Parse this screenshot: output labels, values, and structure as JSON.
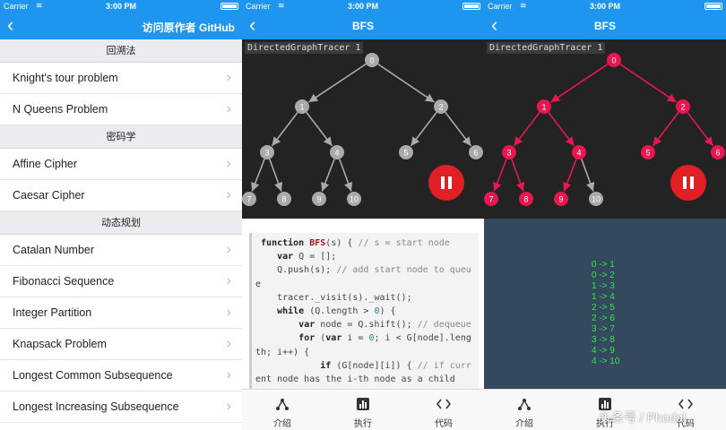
{
  "status": {
    "carrier": "Carrier",
    "time": "3:00 PM"
  },
  "panel1": {
    "nav_title": "访问原作者 GitHub",
    "sections": [
      {
        "title": "回溯法",
        "items": [
          "Knight's tour problem",
          "N Queens Problem"
        ]
      },
      {
        "title": "密码学",
        "items": [
          "Affine Cipher",
          "Caesar Cipher"
        ]
      },
      {
        "title": "动态规划",
        "items": [
          "Catalan Number",
          "Fibonacci Sequence",
          "Integer Partition",
          "Knapsack Problem",
          "Longest Common Subsequence",
          "Longest Increasing Subsequence"
        ]
      }
    ]
  },
  "panel2": {
    "nav_title": "BFS",
    "tracer_label": "DirectedGraphTracer 1"
  },
  "panel3": {
    "nav_title": "BFS",
    "tracer_label": "DirectedGraphTracer 1",
    "log": [
      "0 -> 1",
      "0 -> 2",
      "1 -> 3",
      "1 -> 4",
      "2 -> 5",
      "2 -> 6",
      "3 -> 7",
      "3 -> 8",
      "4 -> 9",
      "4 -> 10"
    ]
  },
  "graph": {
    "nodes": [
      "0",
      "1",
      "2",
      "3",
      "4",
      "5",
      "6",
      "7",
      "8",
      "9",
      "10"
    ],
    "edges": [
      [
        0,
        1
      ],
      [
        0,
        2
      ],
      [
        1,
        3
      ],
      [
        1,
        4
      ],
      [
        2,
        5
      ],
      [
        2,
        6
      ],
      [
        3,
        7
      ],
      [
        3,
        8
      ],
      [
        4,
        9
      ],
      [
        4,
        10
      ]
    ],
    "visited_nodes": [
      0,
      1,
      2,
      3,
      4,
      5,
      6,
      7,
      8,
      9
    ],
    "visited_edges": [
      [
        0,
        1
      ],
      [
        0,
        2
      ],
      [
        1,
        3
      ],
      [
        1,
        4
      ],
      [
        2,
        5
      ],
      [
        2,
        6
      ],
      [
        3,
        7
      ],
      [
        3,
        8
      ],
      [
        4,
        9
      ]
    ],
    "idle_color": "#aaaaaa",
    "visited_color": "#e8174f"
  },
  "code_lines": [
    " function BFS(s) { // s = start node",
    "    var Q = [];",
    "    Q.push(s); // add start node to queu",
    "e",
    "    tracer._visit(s)._wait();",
    "    while (Q.length > 0) {",
    "        var node = Q.shift(); // dequeue",
    "        for (var i = 0; i < G[node].leng",
    "th; i++) {",
    "            if (G[node][i]) { // if curr",
    "ent node has the i-th node as a child"
  ],
  "tabs": [
    {
      "label": "介绍",
      "icon": "intro-icon"
    },
    {
      "label": "执行",
      "icon": "run-icon"
    },
    {
      "label": "代码",
      "icon": "code-icon"
    }
  ],
  "watermark": "头条号 / Phodal",
  "colors": {
    "accent": "#1e96f0",
    "fab": "#e02025",
    "log_text": "#2ee64a",
    "log_bg": "#34495e"
  }
}
